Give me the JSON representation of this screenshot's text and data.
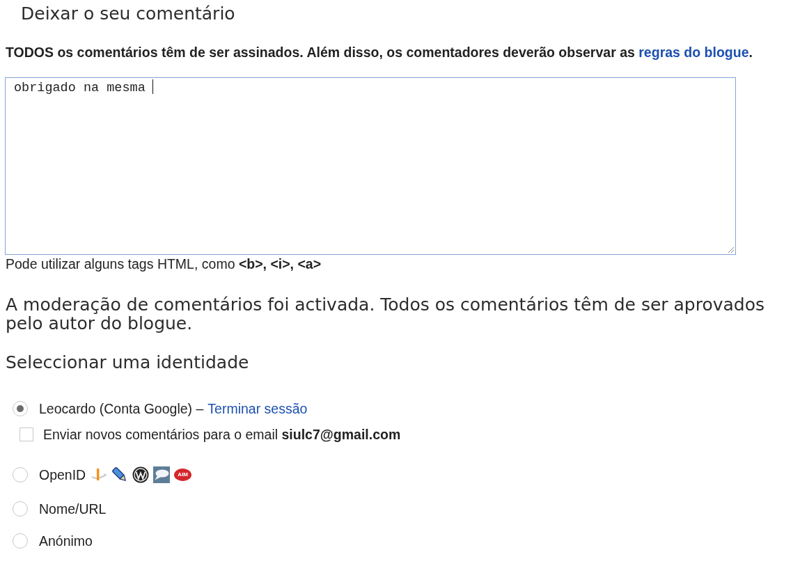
{
  "title": "Deixar o seu comentário",
  "rules_note": {
    "text": "TODOS os comentários têm de ser assinados. Além disso, os comentadores deverão observar as",
    "link": "regras do blogue",
    "suffix": "."
  },
  "comment_box": {
    "value": "obrigado na mesma",
    "focused": true
  },
  "html_hint": "Pode utilizar alguns tags HTML, como **<b>, <i>, <a>**",
  "moderation_notice": "A moderação de comentários foi activada. Todos os comentários têm de ser aprovados pelo autor do blogue.",
  "identity_heading": "Seleccionar uma identidade",
  "identities": [
    {
      "label": "Leocardo (Conta Google) –",
      "link": "Terminar sessão",
      "selected": true,
      "email_option": {
        "text": "Enviar novos comentários para o email **siulc7@gmail.com**",
        "checked": false
      }
    },
    {
      "label": "OpenID",
      "selected": false,
      "provider_icons": [
        {
          "kind": "openid"
        },
        {
          "kind": "pencil"
        },
        {
          "kind": "wordpress"
        },
        {
          "kind": "speech"
        },
        {
          "kind": "oval",
          "text": "AIM"
        }
      ]
    },
    {
      "label": "Nome/URL",
      "selected": false
    },
    {
      "label": "Anónimo",
      "selected": false
    }
  ]
}
